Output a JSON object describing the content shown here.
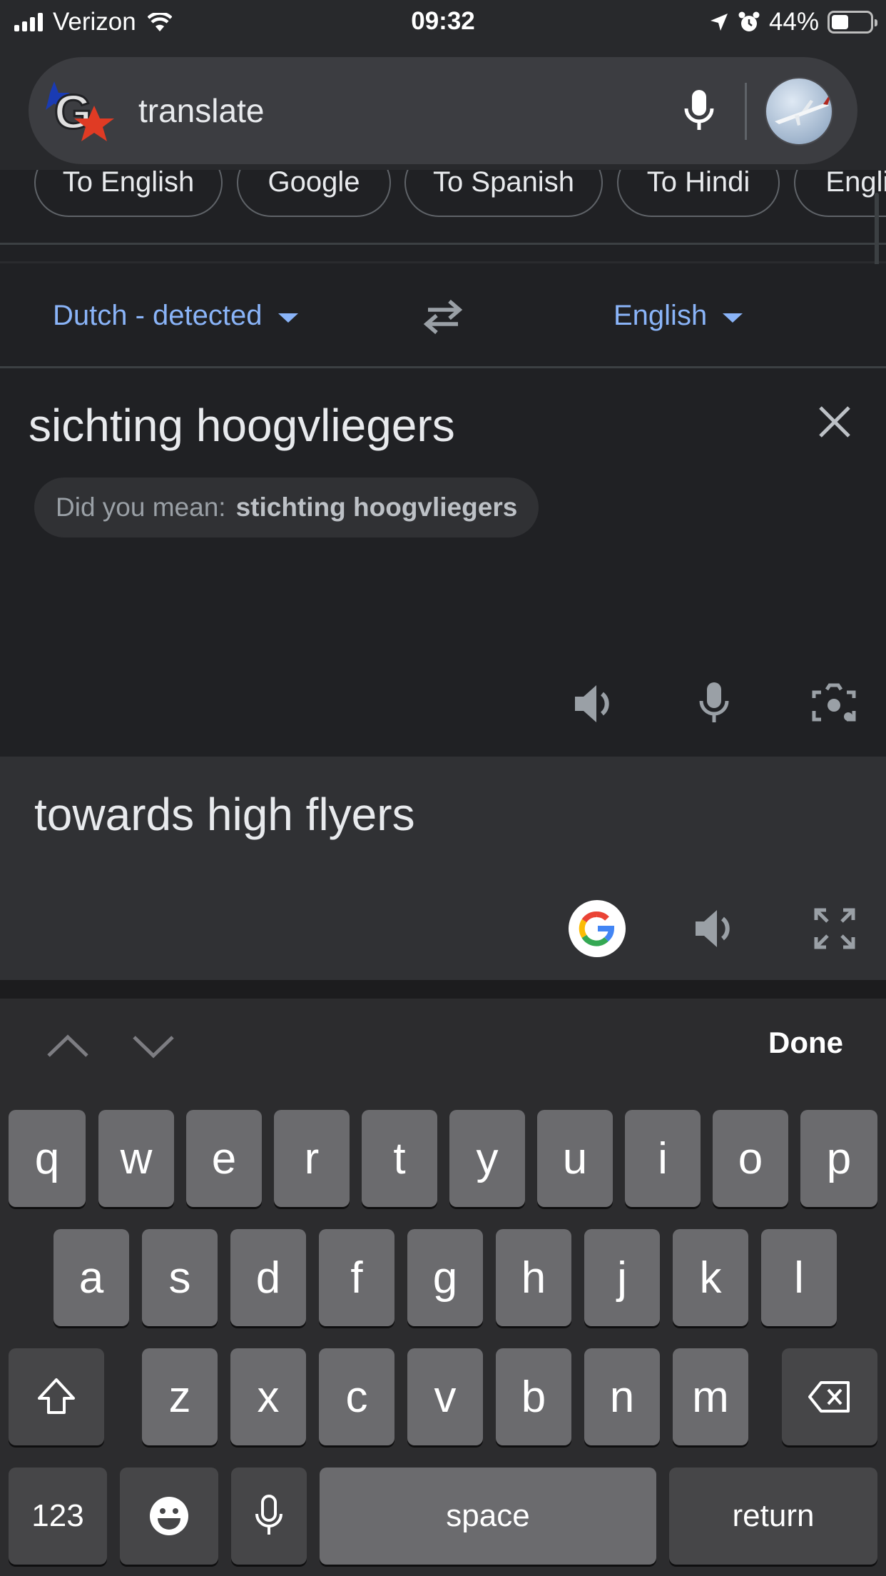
{
  "status_bar": {
    "carrier": "Verizon",
    "time": "09:32",
    "battery": "44%",
    "battery_level": 0.44,
    "icons": [
      "signal-icon",
      "wifi-icon",
      "location-arrow-icon",
      "alarm-icon",
      "battery-icon"
    ]
  },
  "search": {
    "query": "translate",
    "icons": [
      "google-doodle-logo",
      "microphone-icon",
      "profile-avatar"
    ]
  },
  "chips": [
    "To English",
    "Google",
    "To Spanish",
    "To Hindi",
    "English"
  ],
  "languages": {
    "source": "Dutch - detected",
    "target": "English",
    "swap_icon": "swap-arrows-icon"
  },
  "input": {
    "text": "sichting hoogvliegers",
    "suggestion_label": "Did you mean:",
    "suggestion_value": "stichting hoogvliegers",
    "icons": [
      "close-icon",
      "speaker-icon",
      "microphone-icon",
      "camera-icon"
    ]
  },
  "output": {
    "text": "towards high flyers",
    "icons": [
      "google-g-icon",
      "speaker-icon",
      "fullscreen-icon"
    ]
  },
  "keyboard": {
    "done": "Done",
    "row1": [
      "q",
      "w",
      "e",
      "r",
      "t",
      "y",
      "u",
      "i",
      "o",
      "p"
    ],
    "row2": [
      "a",
      "s",
      "d",
      "f",
      "g",
      "h",
      "j",
      "k",
      "l"
    ],
    "row3": [
      "z",
      "x",
      "c",
      "v",
      "b",
      "n",
      "m"
    ],
    "numbers": "123",
    "space": "space",
    "return": "return",
    "icons": [
      "chevron-up-icon",
      "chevron-down-icon",
      "shift-icon",
      "delete-icon",
      "emoji-icon",
      "dictation-icon"
    ]
  },
  "colors": {
    "accent_blue": "#8ab4f8",
    "background": "#202124",
    "output_background": "#303134",
    "key": "#6b6b6e"
  }
}
